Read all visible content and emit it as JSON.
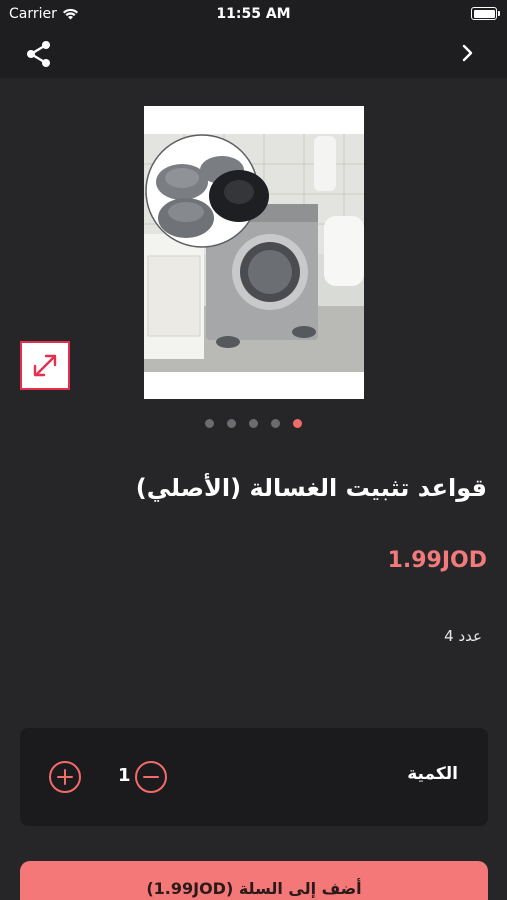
{
  "status_bar": {
    "carrier": "Carrier",
    "time": "11:55 AM"
  },
  "nav": {
    "share_icon": "share-icon",
    "back_icon": "chevron-right-icon"
  },
  "gallery": {
    "image_description": "Anti-vibration washing machine pads",
    "dots_count": 5,
    "active_dot": 4,
    "expand_icon": "expand-arrows-icon"
  },
  "product": {
    "title": "قواعد تثبيت الغسالة (الأصلي)",
    "price": "1.99JOD",
    "note": "عدد 4"
  },
  "quantity": {
    "label": "الكمية",
    "value": "1"
  },
  "cart": {
    "add_label": "أضف إلى السلة (1.99JOD)"
  },
  "colors": {
    "background": "#262629",
    "accent": "#f26b6b",
    "price": "#f27a7a",
    "expand_border": "#e4304f"
  }
}
